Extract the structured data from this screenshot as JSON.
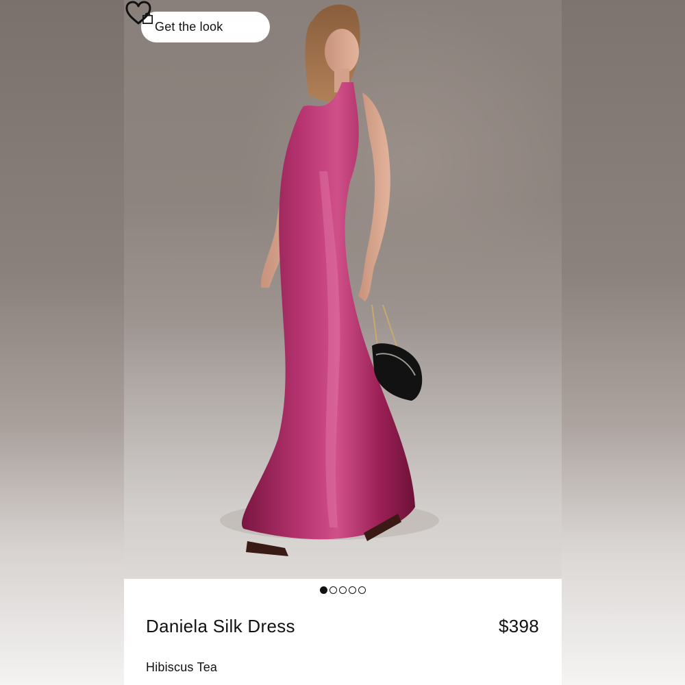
{
  "hero": {
    "get_look_label": "Get the look",
    "icons": {
      "bag": "shopping-bag-icon",
      "heart": "heart-icon"
    },
    "image_description_colors": {
      "dress": "#a8255e",
      "backdrop": "#8e847f"
    }
  },
  "carousel": {
    "total": 5,
    "active_index": 0
  },
  "product": {
    "name": "Daniela Silk Dress",
    "price": "$398",
    "color": "Hibiscus Tea"
  }
}
